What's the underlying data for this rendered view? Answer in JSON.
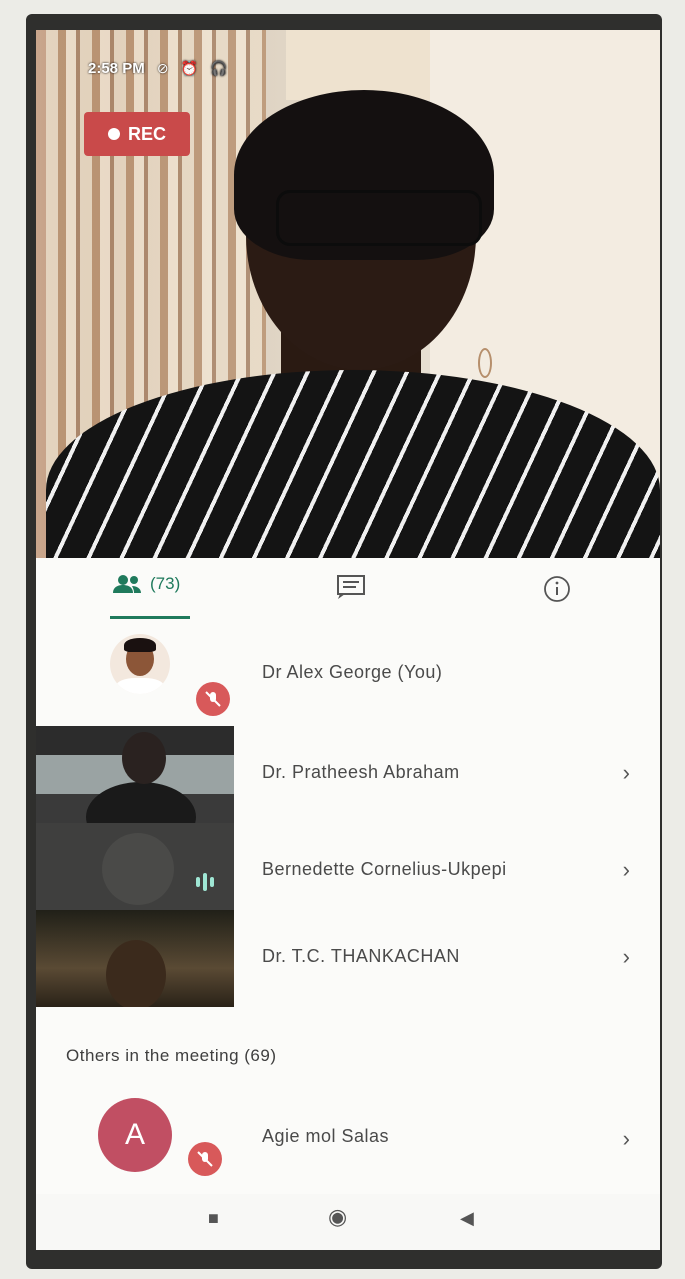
{
  "status_bar": {
    "time": "2:58 PM",
    "icons": [
      "do-not-disturb-icon",
      "alarm-icon",
      "headphones-icon"
    ]
  },
  "recording": {
    "label": "REC"
  },
  "tabs": {
    "people_count": "(73)",
    "chat_icon": "chat-icon",
    "info_icon": "info-icon"
  },
  "participants": [
    {
      "name": "Dr Alex George (You)",
      "muted": true
    },
    {
      "name": "Dr. Pratheesh Abraham"
    },
    {
      "name": "Bernedette Cornelius-Ukpepi",
      "speaking": true
    },
    {
      "name": "Dr. T.C. THANKACHAN"
    }
  ],
  "others": {
    "label": "Others in the meeting (69)",
    "items": [
      {
        "initial": "A",
        "name": "Agie mol Salas",
        "muted": true
      }
    ]
  },
  "colors": {
    "accent": "#1f7a5c",
    "rec": "#c94a4a",
    "mute": "#d8595a",
    "avatar_a": "#c14f63"
  }
}
